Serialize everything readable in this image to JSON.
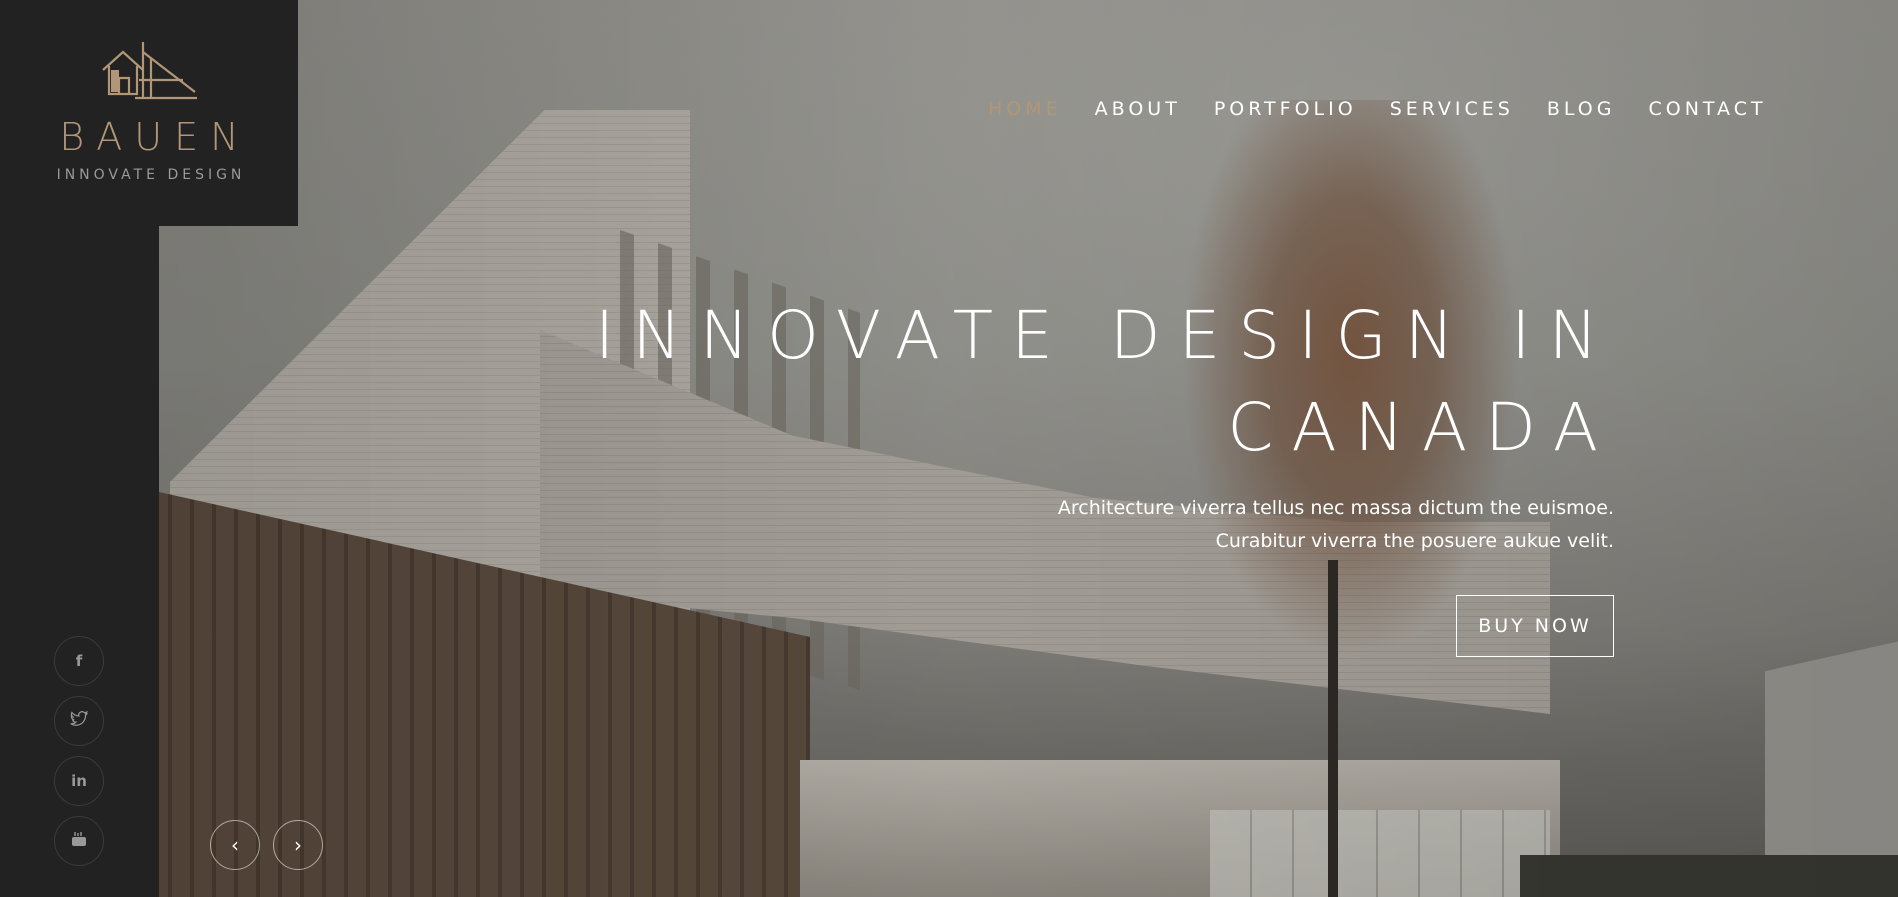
{
  "brand": {
    "title": "BAUEN",
    "subtitle": "INNOVATE DESIGN",
    "accent_color": "#b19777",
    "logo_icon": "house-blueprint-icon"
  },
  "nav": {
    "items": [
      {
        "label": "HOME",
        "active": true
      },
      {
        "label": "ABOUT",
        "active": false
      },
      {
        "label": "PORTFOLIO",
        "active": false
      },
      {
        "label": "SERVICES",
        "active": false
      },
      {
        "label": "BLOG",
        "active": false
      },
      {
        "label": "CONTACT",
        "active": false
      }
    ]
  },
  "hero": {
    "headline_line1": "INNOVATE DESIGN IN",
    "headline_line2": "CANADA",
    "text_line1": "Architecture viverra tellus nec massa dictum the euismoe.",
    "text_line2": "Curabitur viverra the posuere aukue velit.",
    "cta_label": "BUY NOW"
  },
  "social": [
    {
      "icon": "facebook-icon",
      "glyph": "f"
    },
    {
      "icon": "twitter-icon",
      "glyph": "🐦"
    },
    {
      "icon": "linkedin-icon",
      "glyph": "in"
    },
    {
      "icon": "youtube-icon",
      "glyph": "▶"
    }
  ],
  "slider": {
    "prev_glyph": "‹",
    "next_glyph": "›"
  }
}
